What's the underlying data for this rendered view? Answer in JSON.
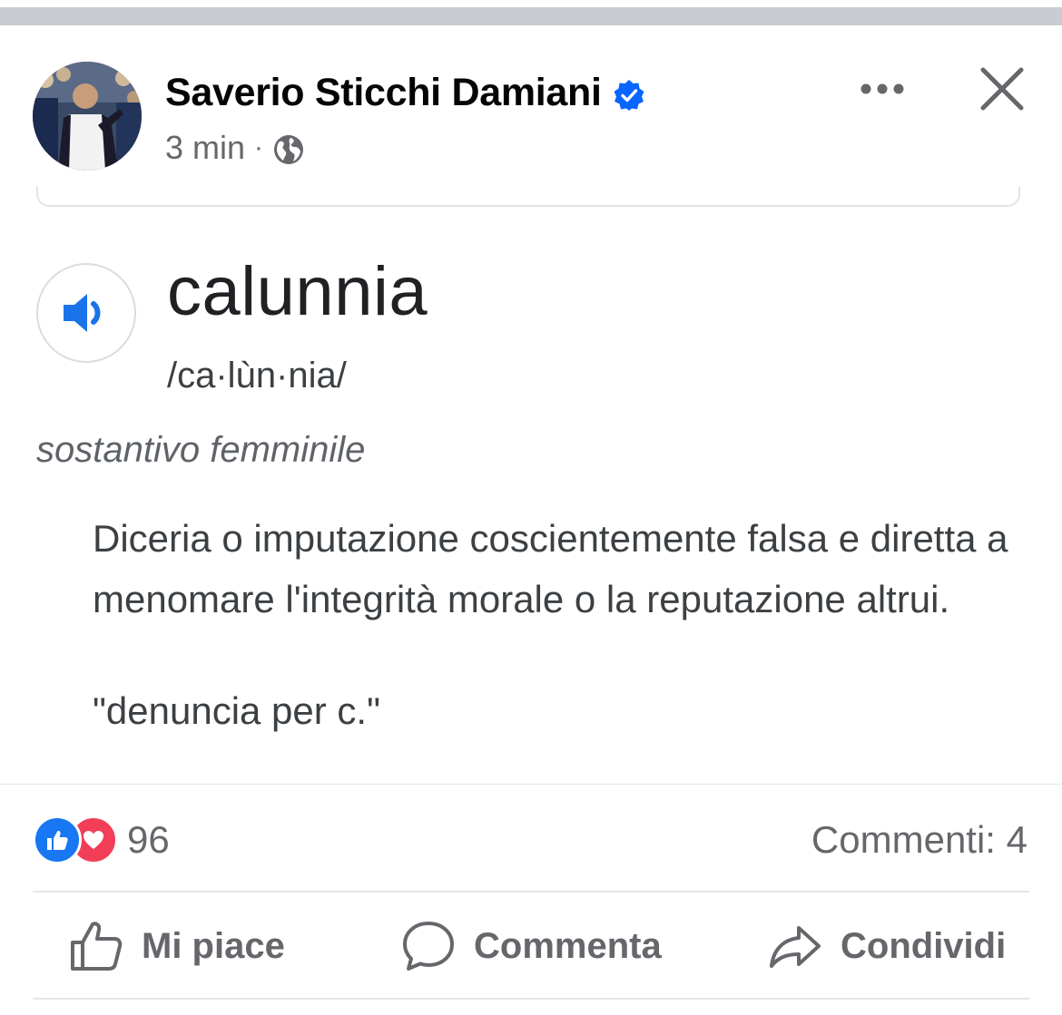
{
  "post": {
    "author": "Saverio Sticchi Damiani",
    "time": "3 min",
    "separator": "·"
  },
  "dictionary": {
    "word": "calunnia",
    "phonetic": "/ca·lùn·nia/",
    "part_of_speech": "sostantivo femminile",
    "definition": "Diceria o imputazione coscientemente falsa e diretta a menomare l'integrità morale o la reputazione altrui.",
    "example": "\"denuncia per c.\""
  },
  "stats": {
    "reactions_count": "96",
    "comments": "Commenti: 4"
  },
  "actions": {
    "like": "Mi piace",
    "comment": "Commenta",
    "share": "Condividi"
  },
  "colors": {
    "like_blue": "#1877f2",
    "love_red": "#f33e58",
    "verified_blue": "#0866ff",
    "secondary_text": "#65676b"
  },
  "icons": [
    "verified-badge-icon",
    "globe-icon",
    "more-icon",
    "close-icon",
    "speaker-icon",
    "like-reaction-icon",
    "love-reaction-icon",
    "thumbs-up-icon",
    "comment-bubble-icon",
    "share-arrow-icon"
  ]
}
